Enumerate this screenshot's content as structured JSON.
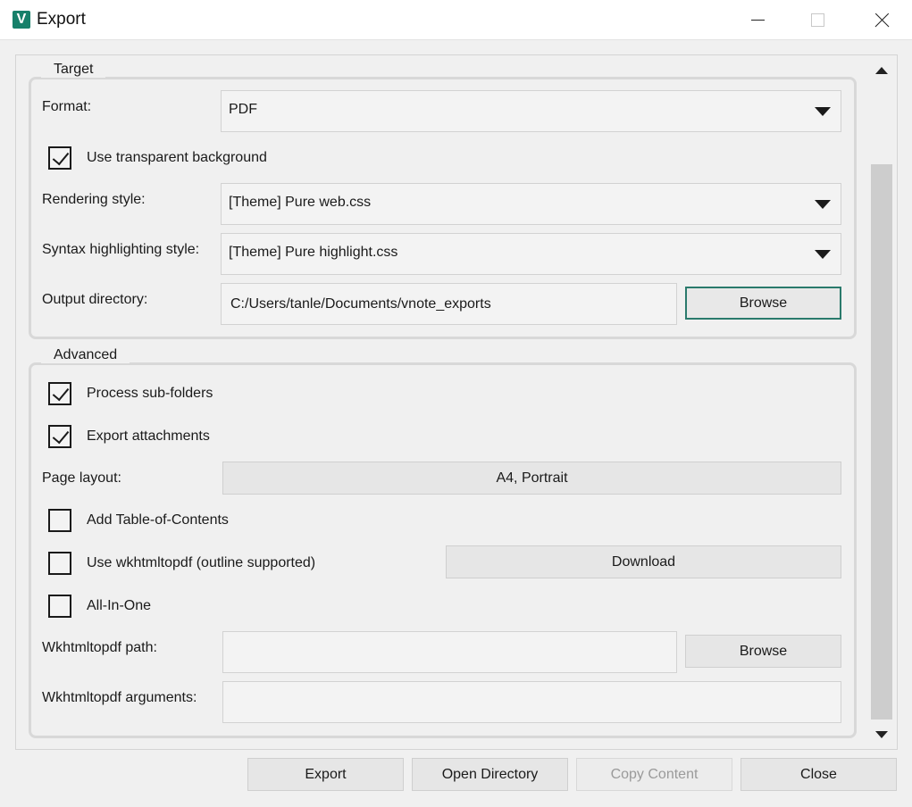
{
  "window": {
    "title": "Export",
    "app_icon_letter": "V",
    "accent_color": "#17806a"
  },
  "target": {
    "group_title": "Target",
    "format_label": "Format:",
    "format_value": "PDF",
    "transparent_bg_label": "Use transparent background",
    "transparent_bg_checked": true,
    "rendering_style_label": "Rendering style:",
    "rendering_style_value": "[Theme] Pure web.css",
    "syntax_style_label": "Syntax highlighting style:",
    "syntax_style_value": "[Theme] Pure highlight.css",
    "output_dir_label": "Output directory:",
    "output_dir_value": "C:/Users/tanle/Documents/vnote_exports",
    "browse_label": "Browse"
  },
  "advanced": {
    "group_title": "Advanced",
    "process_subfolders_label": "Process sub-folders",
    "process_subfolders_checked": true,
    "export_attachments_label": "Export attachments",
    "export_attachments_checked": true,
    "page_layout_label": "Page layout:",
    "page_layout_value": "A4, Portrait",
    "add_toc_label": "Add Table-of-Contents",
    "add_toc_checked": false,
    "use_wkhtmltopdf_label": "Use wkhtmltopdf (outline supported)",
    "use_wkhtmltopdf_checked": false,
    "download_label": "Download",
    "all_in_one_label": "All-In-One",
    "all_in_one_checked": false,
    "wk_path_label": "Wkhtmltopdf path:",
    "wk_path_value": "",
    "wk_browse_label": "Browse",
    "wk_args_label": "Wkhtmltopdf arguments:",
    "wk_args_value": ""
  },
  "footer": {
    "export_label": "Export",
    "open_dir_label": "Open Directory",
    "copy_content_label": "Copy Content",
    "close_label": "Close"
  }
}
